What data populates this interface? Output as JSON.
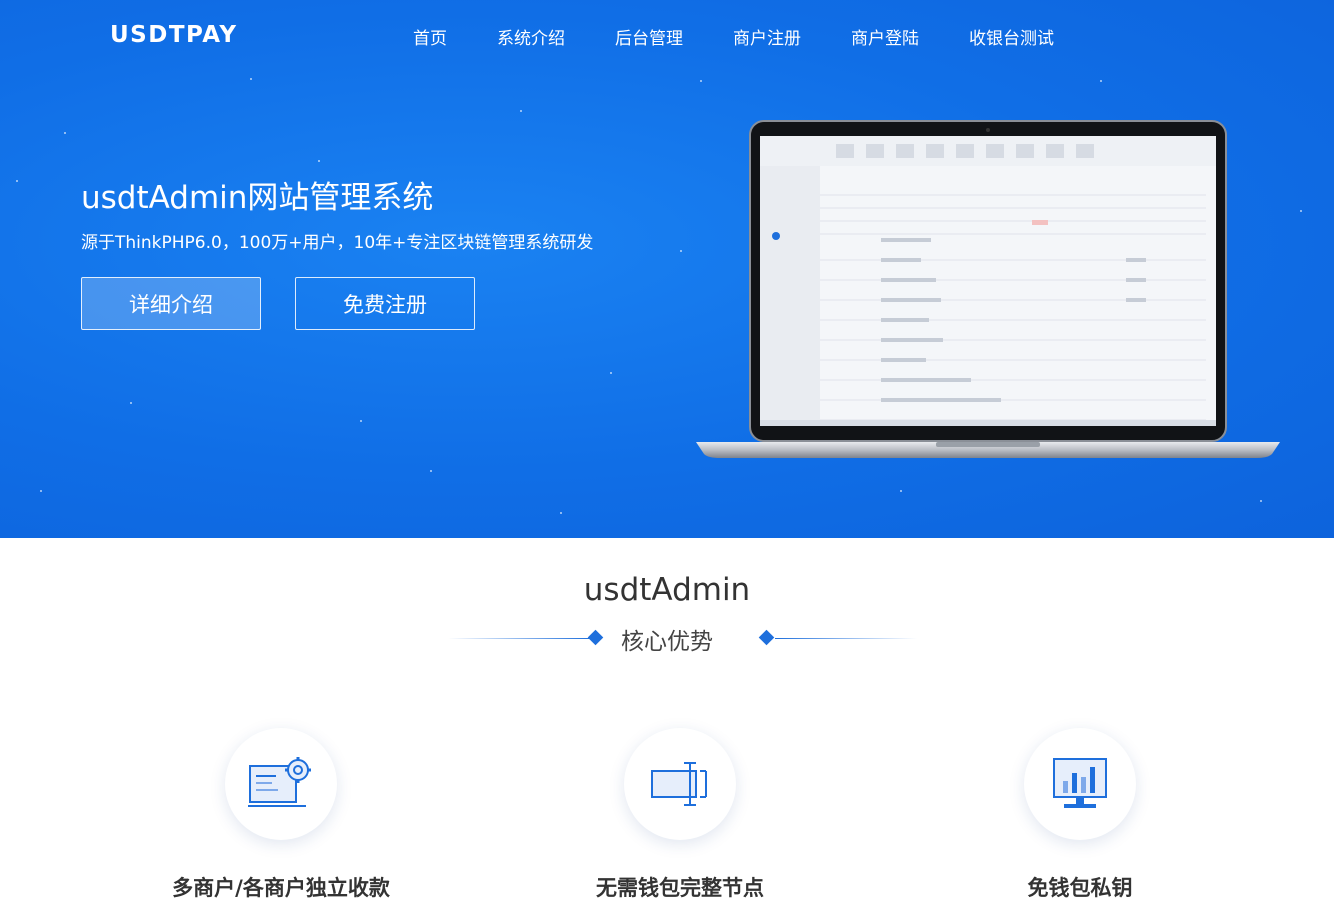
{
  "brand": {
    "logo": "USDTPAY"
  },
  "nav": {
    "items": [
      "首页",
      "系统介绍",
      "后台管理",
      "商户注册",
      "商户登陆",
      "收银台测试"
    ]
  },
  "hero": {
    "title": "usdtAdmin网站管理系统",
    "subtitle": "源于ThinkPHP6.0，100万+用户，10年+专注区块链管理系统研发",
    "detail_button": "详细介绍",
    "register_button": "免费注册"
  },
  "section": {
    "title": "usdtAdmin",
    "subtitle": "核心优势"
  },
  "features": [
    {
      "label": "多商户/各商户独立收款",
      "icon": "dashboard-gear-icon"
    },
    {
      "label": "无需钱包完整节点",
      "icon": "text-cursor-box-icon"
    },
    {
      "label": "免钱包私钥",
      "icon": "monitor-chart-icon"
    }
  ],
  "colors": {
    "hero_bg": "#106ee6",
    "accent": "#1e6fdc",
    "text": "#333333"
  }
}
